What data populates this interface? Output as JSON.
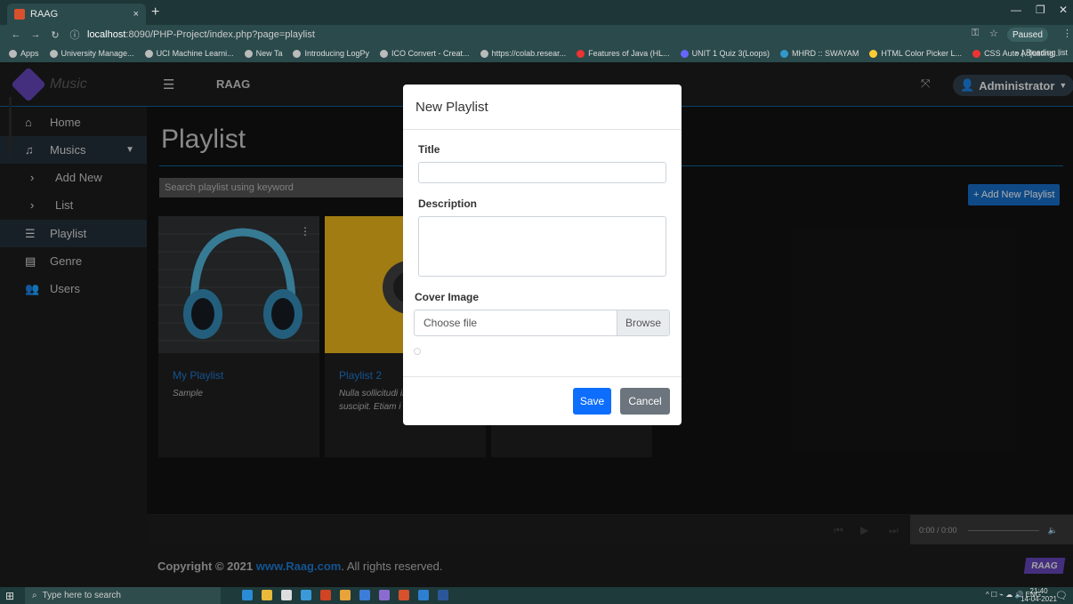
{
  "browser": {
    "tab_title": "RAAG",
    "tab_close": "×",
    "new_tab": "+",
    "url_host": "localhost",
    "url_rest": ":8090/PHP-Project/index.php?page=playlist",
    "paused_label": "Paused",
    "bookmarks": [
      "Apps",
      "University Manage...",
      "UCI Machine Learni...",
      "New Ta",
      "Introducing LogPy",
      "ICO Convert - Creat...",
      "https://colab.resear...",
      "Features of Java (HL...",
      "UNIT 1 Quiz 3(Loops)",
      "MHRD :: SWAYAM",
      "HTML Color Picker L...",
      "CSS Auto Adjusting..."
    ],
    "reading_list": "» | Reading list"
  },
  "sidebar": {
    "logo_text": "Music",
    "items": [
      {
        "label": "Home",
        "icon": "⌂"
      },
      {
        "label": "Musics",
        "icon": "♫"
      },
      {
        "label": "Add New",
        "icon": "›"
      },
      {
        "label": "List",
        "icon": "›"
      },
      {
        "label": "Playlist",
        "icon": "☰"
      },
      {
        "label": "Genre",
        "icon": "▤"
      },
      {
        "label": "Users",
        "icon": "👥"
      }
    ]
  },
  "header": {
    "title": "RAAG",
    "user": "Administrator"
  },
  "main": {
    "page_title": "Playlist",
    "search_placeholder": "Search playlist using keyword",
    "add_button": "+ Add New Playlist",
    "cards": [
      {
        "title": "My Playlist",
        "description": "Sample"
      },
      {
        "title": "Playlist 2",
        "description": "Nulla sollicitudi interdum. Nam suscipit. Etiam i"
      }
    ]
  },
  "player": {
    "time": "0:00 / 0:00"
  },
  "footer": {
    "copyright": "Copyright © 2021",
    "link": "www.Raag.com",
    "rest": ". All rights reserved.",
    "logo": "RAAG"
  },
  "modal": {
    "title": "New Playlist",
    "title_label": "Title",
    "title_value": "",
    "description_label": "Description",
    "description_value": "",
    "cover_label": "Cover Image",
    "choose_file": "Choose file",
    "browse": "Browse",
    "save": "Save",
    "cancel": "Cancel"
  },
  "taskbar": {
    "search_placeholder": "Type here to search",
    "lang": "ENG",
    "time": "21:40",
    "date": "14-04-2021"
  },
  "colors": {
    "accent_blue": "#0d6efd",
    "link_blue": "#1b6fc0",
    "brand_purple": "#5b3fa8"
  }
}
